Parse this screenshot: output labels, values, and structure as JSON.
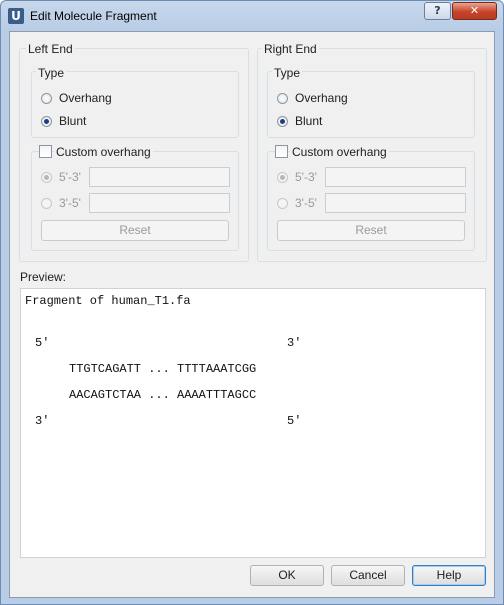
{
  "window": {
    "title": "Edit Molecule Fragment",
    "app_icon_letter": "U",
    "help_glyph": "?",
    "close_glyph": "✕"
  },
  "left_end": {
    "title": "Left End",
    "type_title": "Type",
    "overhang_label": "Overhang",
    "blunt_label": "Blunt",
    "selected_type": "Blunt",
    "custom_overhang_label": "Custom overhang",
    "custom_overhang_checked": false,
    "strand_53_label": "5'-3'",
    "strand_35_label": "3'-5'",
    "strand_53_value": "",
    "strand_35_value": "",
    "reset_label": "Reset"
  },
  "right_end": {
    "title": "Right End",
    "type_title": "Type",
    "overhang_label": "Overhang",
    "blunt_label": "Blunt",
    "selected_type": "Blunt",
    "custom_overhang_label": "Custom overhang",
    "custom_overhang_checked": false,
    "strand_53_label": "5'-3'",
    "strand_35_label": "3'-5'",
    "strand_53_value": "",
    "strand_35_value": "",
    "reset_label": "Reset"
  },
  "preview": {
    "label": "Preview:",
    "fragment_title": "Fragment of human_T1.fa",
    "top_left_end": "5'",
    "top_right_end": "3'",
    "top_strand": "TTGTCAGATT ... TTTTAAATCGG",
    "bottom_strand": "AACAGTCTAA ... AAAATTTAGCC",
    "bottom_left_end": "3'",
    "bottom_right_end": "5'"
  },
  "buttons": {
    "ok": "OK",
    "cancel": "Cancel",
    "help": "Help"
  },
  "colors": {
    "title_bar": "#b9cde6",
    "close_button": "#c7432a",
    "dialog_background": "#f0f0f0",
    "default_button_border": "#3b7bbf"
  }
}
